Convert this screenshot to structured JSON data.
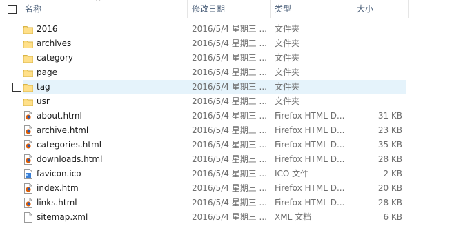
{
  "columns": {
    "name": "名称",
    "date": "修改日期",
    "type": "类型",
    "size": "大小"
  },
  "rows": [
    {
      "name": "2016",
      "date": "2016/5/4 星期三 ...",
      "type": "文件夹",
      "size": "",
      "icon": "folder-icon"
    },
    {
      "name": "archives",
      "date": "2016/5/4 星期三 ...",
      "type": "文件夹",
      "size": "",
      "icon": "folder-icon"
    },
    {
      "name": "category",
      "date": "2016/5/4 星期三 ...",
      "type": "文件夹",
      "size": "",
      "icon": "folder-icon"
    },
    {
      "name": "page",
      "date": "2016/5/4 星期三 ...",
      "type": "文件夹",
      "size": "",
      "icon": "folder-icon"
    },
    {
      "name": "tag",
      "date": "2016/5/4 星期三 ...",
      "type": "文件夹",
      "size": "",
      "icon": "folder-icon"
    },
    {
      "name": "usr",
      "date": "2016/5/4 星期三 ...",
      "type": "文件夹",
      "size": "",
      "icon": "folder-icon"
    },
    {
      "name": "about.html",
      "date": "2016/5/4 星期三 ...",
      "type": "Firefox HTML D...",
      "size": "31 KB",
      "icon": "firefox-html-icon"
    },
    {
      "name": "archive.html",
      "date": "2016/5/4 星期三 ...",
      "type": "Firefox HTML D...",
      "size": "23 KB",
      "icon": "firefox-html-icon"
    },
    {
      "name": "categories.html",
      "date": "2016/5/4 星期三 ...",
      "type": "Firefox HTML D...",
      "size": "35 KB",
      "icon": "firefox-html-icon"
    },
    {
      "name": "downloads.html",
      "date": "2016/5/4 星期三 ...",
      "type": "Firefox HTML D...",
      "size": "28 KB",
      "icon": "firefox-html-icon"
    },
    {
      "name": "favicon.ico",
      "date": "2016/5/4 星期三 ...",
      "type": "ICO 文件",
      "size": "2 KB",
      "icon": "ico-file-icon"
    },
    {
      "name": "index.htm",
      "date": "2016/5/4 星期三 ...",
      "type": "Firefox HTML D...",
      "size": "20 KB",
      "icon": "firefox-html-icon"
    },
    {
      "name": "links.html",
      "date": "2016/5/4 星期三 ...",
      "type": "Firefox HTML D...",
      "size": "28 KB",
      "icon": "firefox-html-icon"
    },
    {
      "name": "sitemap.xml",
      "date": "2016/5/4 星期三 ...",
      "type": "XML 文档",
      "size": "6 KB",
      "icon": "xml-file-icon"
    }
  ],
  "hovered_row": 4,
  "colors": {
    "hover": "#e5f3fb",
    "folder": "#f8d775",
    "header_text": "#4c607a"
  }
}
